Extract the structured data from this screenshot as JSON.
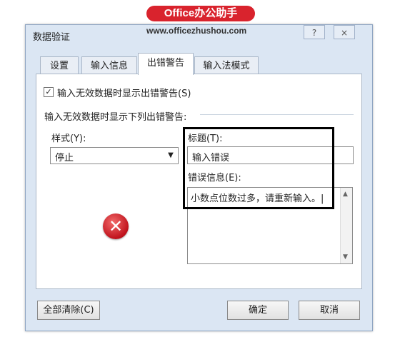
{
  "watermark": {
    "brand": "Office办公助手",
    "url": "www.officezhushou.com"
  },
  "dialog": {
    "title": "数据验证",
    "help_label": "?",
    "close_label": "×",
    "tabs": [
      {
        "label": "设置",
        "active": false
      },
      {
        "label": "输入信息",
        "active": false
      },
      {
        "label": "出错警告",
        "active": true
      },
      {
        "label": "输入法模式",
        "active": false
      }
    ],
    "checkbox": {
      "label": "输入无效数据时显示出错警告(S)",
      "checked": true,
      "mark": "✓"
    },
    "section_label": "输入无效数据时显示下列出错警告:",
    "style": {
      "label": "样式(Y):",
      "value": "停止",
      "arrow": "▼"
    },
    "title_field": {
      "label": "标题(T):",
      "value": "输入错误"
    },
    "error_message": {
      "label": "错误信息(E):",
      "value": "小数点位数过多，请重新输入。|"
    },
    "icon": "error-stop-icon",
    "icon_glyph": "✕",
    "buttons": {
      "clear_all": "全部清除(C)",
      "ok": "确定",
      "cancel": "取消"
    }
  },
  "colors": {
    "accent_red": "#d9232d",
    "dialog_bg": "#dbe6f3"
  }
}
